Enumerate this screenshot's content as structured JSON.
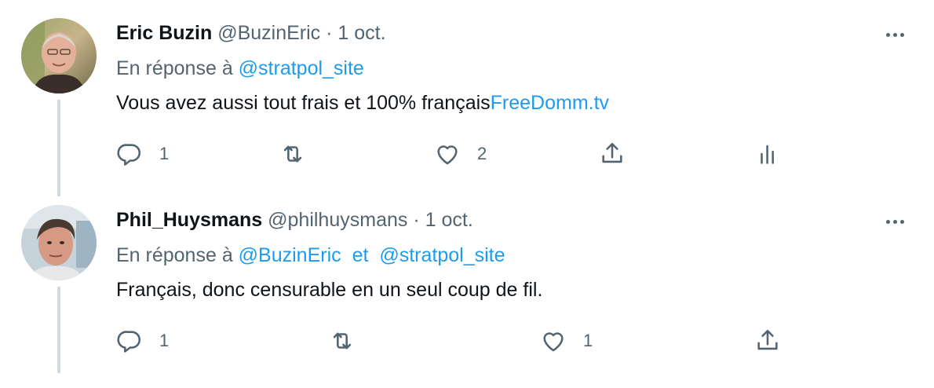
{
  "tweets": [
    {
      "name": "Eric Buzin",
      "handle": "@BuzinEric",
      "separator": "·",
      "date": "1 oct.",
      "reply_prefix": "En réponse à",
      "reply_mentions": [
        "@stratpol_site"
      ],
      "text": "Vous avez aussi tout frais et 100% français",
      "link": "FreeDomm.tv",
      "replies": "1",
      "retweets": "",
      "likes": "2"
    },
    {
      "name": "Phil_Huysmans",
      "handle": "@philhuysmans",
      "separator": "·",
      "date": "1 oct.",
      "reply_prefix": "En réponse à",
      "reply_mentions": [
        "@BuzinEric",
        "@stratpol_site"
      ],
      "reply_conjunction": "et",
      "text": "Français, donc censurable en un seul coup de fil.",
      "replies": "1",
      "retweets": "",
      "likes": "1"
    }
  ],
  "icons": {
    "reply": "reply-icon",
    "retweet": "retweet-icon",
    "like": "heart-icon",
    "share": "share-icon",
    "analytics": "analytics-icon",
    "more": "more-icon"
  },
  "colors": {
    "text": "#0f1419",
    "secondary": "#536471",
    "link": "#1d9bf0",
    "thread_line": "#cfd9de"
  }
}
